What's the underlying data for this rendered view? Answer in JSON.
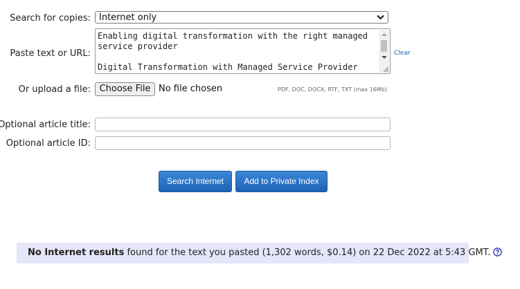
{
  "form": {
    "search_label": "Search for copies:",
    "search_value": "Internet only",
    "paste_label": "Paste text or URL:",
    "paste_text": "Enabling digital transformation with the right managed service provider\n\nDigital Transformation with Managed Service Provider",
    "clear_label": "Clear",
    "upload_label": "Or upload a file:",
    "choose_file_label": "Choose File",
    "file_status": "No file chosen",
    "file_hint": "PDF, DOC, DOCX, RTF, TXT (max 16Mb)",
    "title_label": "Optional article title:",
    "title_value": "",
    "id_label": "Optional article ID:",
    "id_value": ""
  },
  "buttons": {
    "search_internet": "Search Internet",
    "add_private_index": "Add to Private Index"
  },
  "result": {
    "bold": "No Internet results",
    "rest": " found for the text you pasted (1,302 words, $0.14) on 22 Dec 2022 at 5:43 GMT."
  },
  "colors": {
    "button": "#2a72c8",
    "result_background": "#e5e6f9",
    "link": "#1a5fb4"
  },
  "icons": {
    "select": "chevron-down-icon",
    "help": "question-circle-icon"
  }
}
